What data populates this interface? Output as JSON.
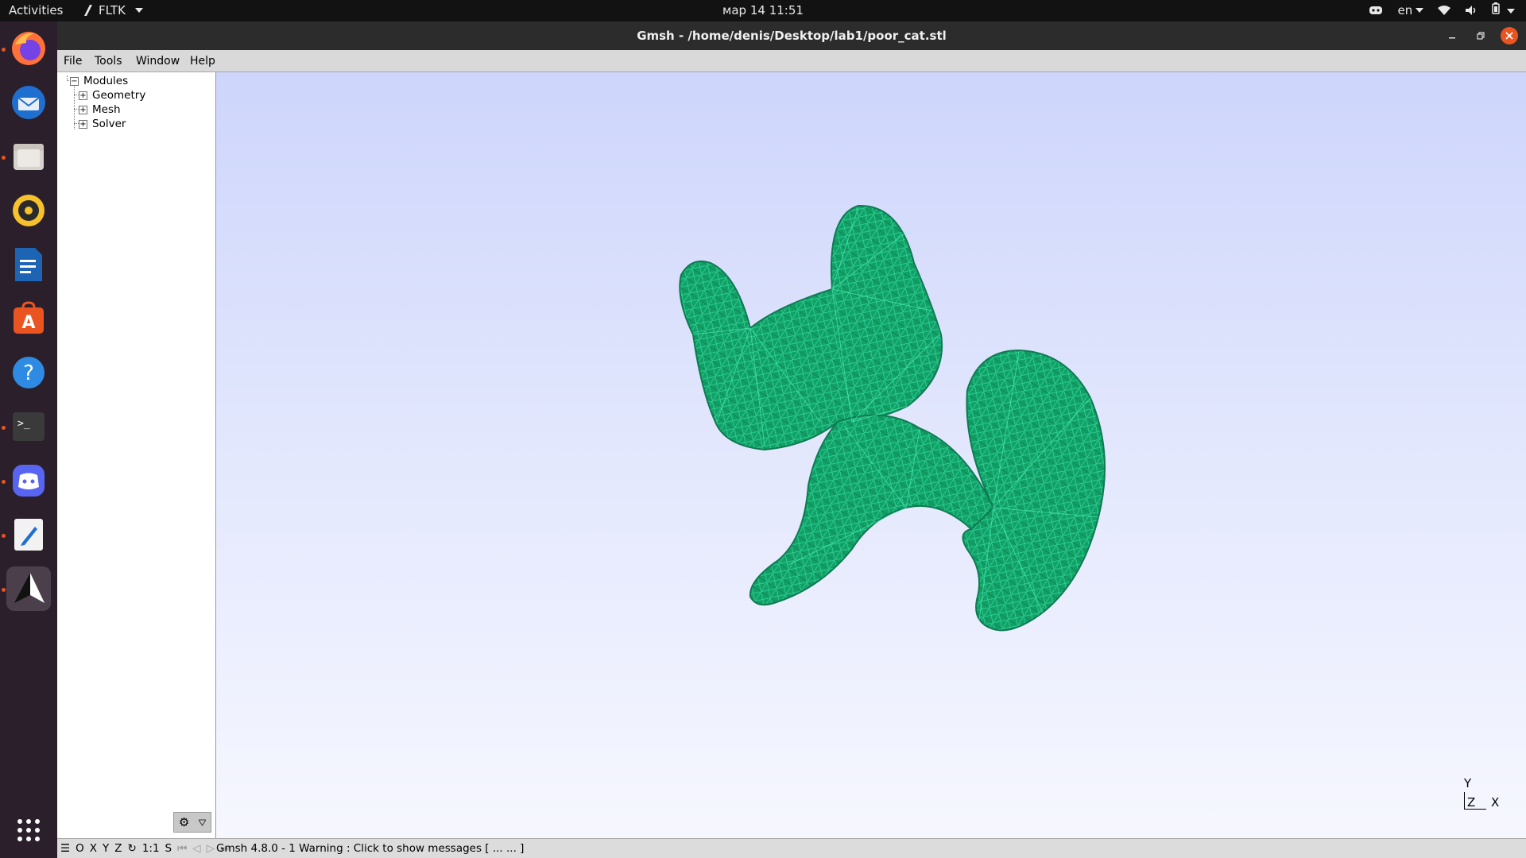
{
  "topbar": {
    "activities": "Activities",
    "app_name": "FLTK",
    "clock": "мар 14  11:51",
    "language": "en"
  },
  "window": {
    "title": "Gmsh - /home/denis/Desktop/lab1/poor_cat.stl"
  },
  "menu": [
    "File",
    "Tools",
    "Window",
    "Help"
  ],
  "tree": {
    "root": "Modules",
    "children": [
      "Geometry",
      "Mesh",
      "Solver"
    ]
  },
  "axes": {
    "y": "Y",
    "z": "Z",
    "x": "X"
  },
  "statusbar": {
    "view_buttons": [
      "O",
      "X",
      "Y",
      "Z",
      "1:1",
      "S"
    ],
    "message": "Gmsh 4.8.0  -   1 Warning : Click to show messages [ ...  ... ]"
  },
  "colors": {
    "mesh_fill": "#12a067",
    "mesh_edge": "#3ef2b5",
    "dock_active_dot": "#e95420",
    "close_button": "#e95420"
  }
}
